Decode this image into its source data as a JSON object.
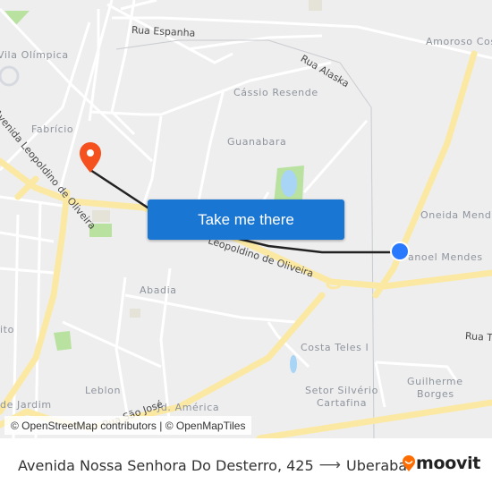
{
  "map": {
    "neighborhood_labels": [
      {
        "id": "vila-olimpica",
        "text": "Vila Olímpica"
      },
      {
        "id": "fabricio",
        "text": "Fabrício"
      },
      {
        "id": "cassio-resende",
        "text": "Cássio Resende"
      },
      {
        "id": "guanabara",
        "text": "Guanabara"
      },
      {
        "id": "amoroso-costa",
        "text": "Amoroso Cos"
      },
      {
        "id": "oneida-mendes",
        "text": "Oneida Mend"
      },
      {
        "id": "manoel-mendes",
        "text": "anoel Mendes"
      },
      {
        "id": "abadia",
        "text": "Abadia"
      },
      {
        "id": "vito",
        "text": "ito"
      },
      {
        "id": "costa-teles",
        "text": "Costa Teles I"
      },
      {
        "id": "setor-silverio",
        "text": "Setor Silvério"
      },
      {
        "id": "cartafina",
        "text": "Cartafina"
      },
      {
        "id": "guilherme",
        "text": "Guilherme"
      },
      {
        "id": "borges",
        "text": "Borges"
      },
      {
        "id": "leblon",
        "text": "Leblon"
      },
      {
        "id": "jardim",
        "text": "de Jardim"
      },
      {
        "id": "jd-america",
        "text": "Jd. América"
      }
    ],
    "road_labels": [
      {
        "id": "rua-espanha",
        "text": "Rua Espanha"
      },
      {
        "id": "rua-alaska",
        "text": "Rua Alaska"
      },
      {
        "id": "av-leopoldino-left",
        "text": "Avenida Leopoldino de Oliveira"
      },
      {
        "id": "av-leopoldino-mid",
        "text": "Leopoldino de Oliveira"
      },
      {
        "id": "rua-t",
        "text": "Rua T"
      },
      {
        "id": "rua-sao-jose",
        "text": "Rua São José"
      }
    ],
    "cta_label": "Take me there",
    "attribution": "© OpenStreetMap contributors | © OpenMapTiles",
    "origin_color": "#f4511e",
    "destination_color": "#2979ff",
    "button_color": "#1976d2"
  },
  "footer": {
    "origin": "Avenida Nossa Senhora Do Desterro, 425",
    "arrow": "⟶",
    "destination": "Uberaba",
    "brand": "moovit",
    "brand_color": "#ff6d00"
  }
}
